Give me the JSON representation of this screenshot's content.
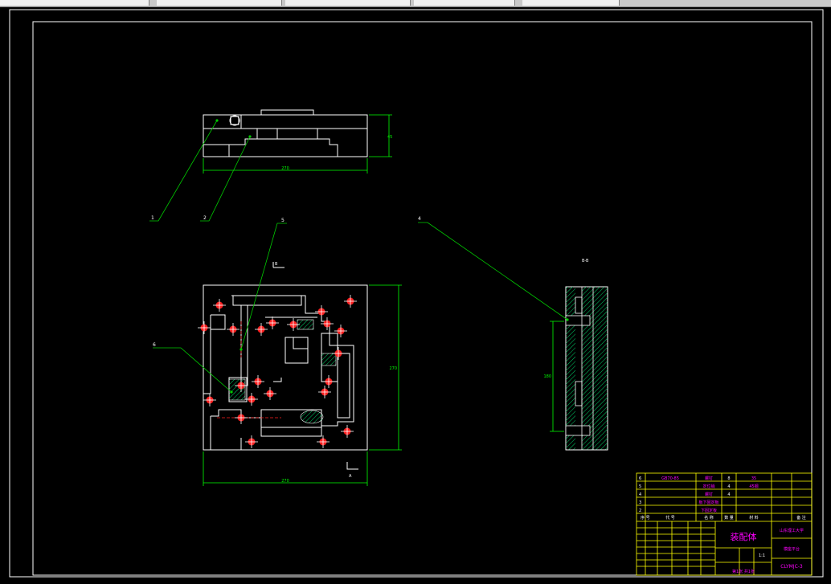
{
  "tabs": [
    "",
    "",
    "",
    "",
    ""
  ],
  "colors": {
    "background": "#000000",
    "outline": "#ffffff",
    "leader": "#00cc00",
    "dimension": "#00ff00",
    "title_text": "#ff00ff",
    "table_lines": "#ffff00",
    "hole_marker": "#ff2020",
    "hatch": "#00cc66",
    "tab_bg": "#f2f2f2"
  },
  "drawing": {
    "balloons": [
      "1",
      "2",
      "5",
      "4",
      "6"
    ],
    "top_view": {
      "width_dim": "270",
      "height_dim": "45"
    },
    "plan_view": {
      "width_dim": "270",
      "height_dim": "270",
      "section_mark_top": "B",
      "section_mark_bottom": "A"
    },
    "side_view": {
      "label": "B-B",
      "dim": "180"
    }
  },
  "title_block": {
    "parts": [
      {
        "no": "6",
        "code": "GB70-85",
        "name": "螺钉",
        "qty": "8",
        "material": "35"
      },
      {
        "no": "5",
        "code": "",
        "name": "定位销",
        "qty": "4",
        "material": "45钢"
      },
      {
        "no": "4",
        "code": "",
        "name": "螺钉",
        "qty": "4",
        "material": ""
      },
      {
        "no": "3",
        "code": "",
        "name": "板下固定板",
        "qty": "",
        "material": ""
      },
      {
        "no": "2",
        "code": "",
        "name": "下固定板",
        "qty": "",
        "material": ""
      }
    ],
    "header": {
      "no": "序 号",
      "code": "代 号",
      "name": "名 称",
      "qty": "数 量",
      "material": "材 料",
      "note": "备 注"
    },
    "school": "山东理工大学",
    "drawing_name": "装配体",
    "subtitle": "模座平台",
    "drawing_code": "CLYMJC-3",
    "scale": "1:1",
    "sheet": "第1张 共1张"
  }
}
